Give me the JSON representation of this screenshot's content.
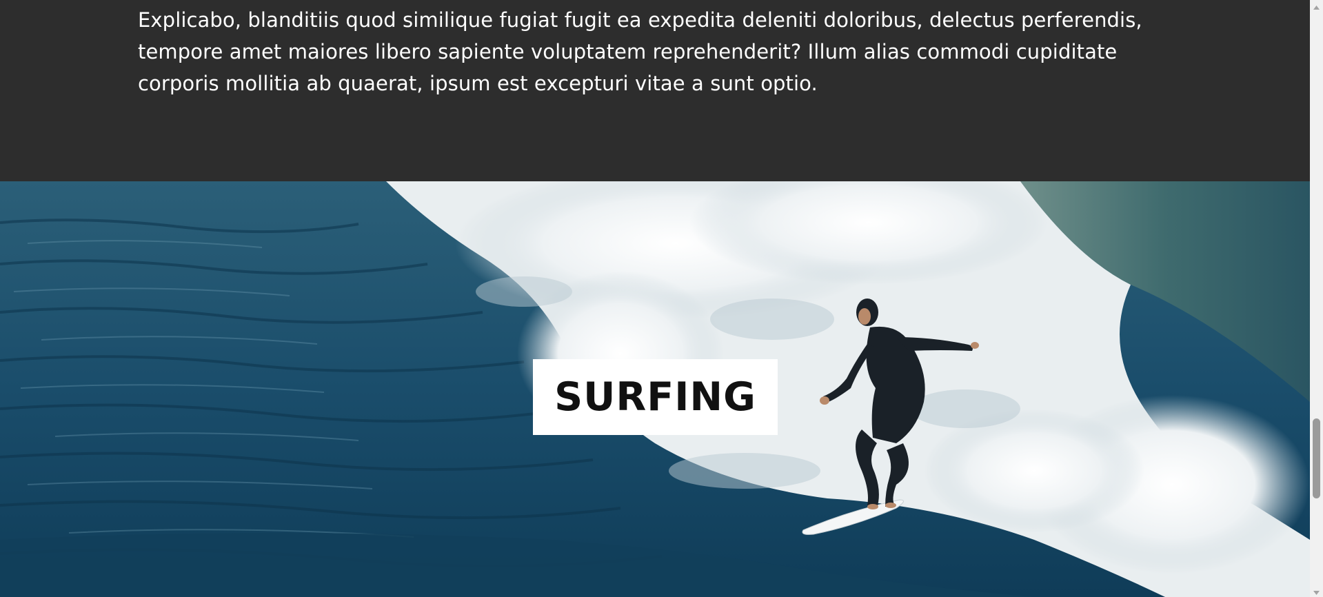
{
  "article": {
    "paragraph": "repudiandae molestiae magnam aut quod consequatur, harum, totam beatae fugiat ipsam? Explicabo, blanditiis quod similique fugiat fugit ea expedita deleniti doloribus, delectus perferendis, tempore amet maiores libero sapiente voluptatem reprehenderit? Illum alias commodi cupiditate corporis mollitia ab quaerat, ipsum est excepturi vitae a sunt optio."
  },
  "banner": {
    "title": "SURFING",
    "image": "surfer-riding-wave"
  },
  "scrollbar": {
    "up_icon": "triangle-up-icon",
    "down_icon": "triangle-down-icon"
  },
  "colors": {
    "section_background": "#2d2d2d",
    "text": "#ffffff",
    "title_box": "#ffffff",
    "title_text": "#111111",
    "ocean": "#1b4f6e"
  }
}
